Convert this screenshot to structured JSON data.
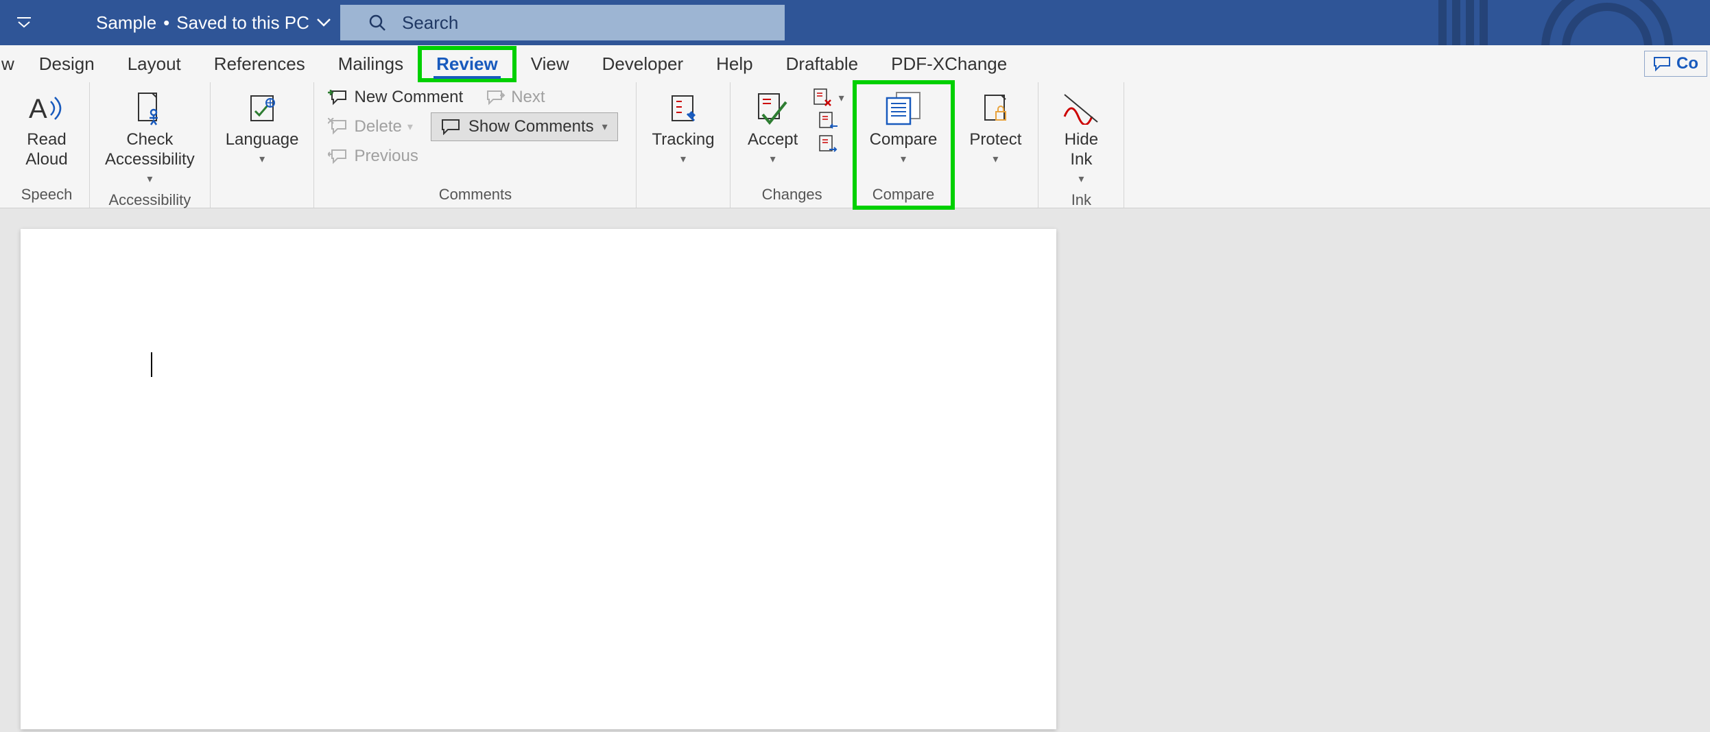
{
  "titlebar": {
    "filename": "Sample",
    "save_status": "Saved to this PC",
    "separator": "•",
    "search_placeholder": "Search"
  },
  "tabs": {
    "partial_left": "w",
    "items": [
      "Design",
      "Layout",
      "References",
      "Mailings",
      "Review",
      "View",
      "Developer",
      "Help",
      "Draftable",
      "PDF-XChange"
    ],
    "active": "Review",
    "comments_partial": "Co"
  },
  "ribbon": {
    "speech": {
      "read_aloud": "Read\nAloud",
      "label": "Speech"
    },
    "accessibility": {
      "check": "Check\nAccessibility",
      "label": "Accessibility"
    },
    "language": {
      "language": "Language"
    },
    "comments": {
      "new_comment": "New Comment",
      "delete": "Delete",
      "previous": "Previous",
      "next": "Next",
      "show_comments": "Show Comments",
      "label": "Comments"
    },
    "tracking": {
      "tracking": "Tracking"
    },
    "changes": {
      "accept": "Accept",
      "label": "Changes"
    },
    "compare": {
      "compare": "Compare",
      "label": "Compare"
    },
    "protect": {
      "protect": "Protect"
    },
    "ink": {
      "hide_ink": "Hide\nInk",
      "label": "Ink"
    }
  }
}
